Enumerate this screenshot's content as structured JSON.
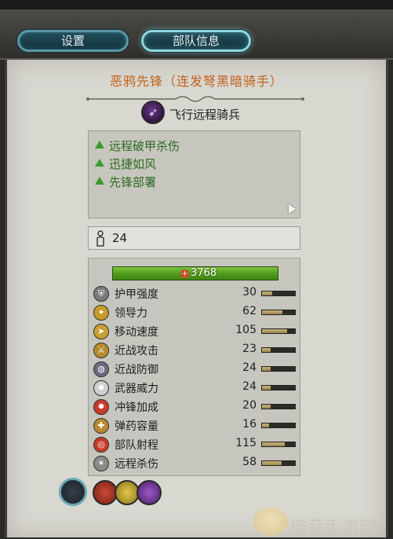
{
  "tabs": [
    {
      "label": "设置",
      "active": false
    },
    {
      "label": "部队信息",
      "active": true
    }
  ],
  "unit": {
    "name": "恶鸦先锋（连发弩黑暗骑手）",
    "class_label": "飞行远程骑兵",
    "class_icon": "crossbow-icon"
  },
  "traits": [
    {
      "label": "远程破甲杀伤",
      "icon": "green-triangle-icon"
    },
    {
      "label": "迅捷如风",
      "icon": "green-triangle-icon"
    },
    {
      "label": "先锋部署",
      "icon": "green-triangle-icon"
    }
  ],
  "men": {
    "icon": "soldier-icon",
    "value": "24"
  },
  "hp": {
    "value": "3768",
    "fraction": 1.0
  },
  "stats": [
    {
      "label": "护甲强度",
      "value": "30",
      "fraction": 0.3,
      "icon": "armor-icon",
      "color": "#7a7a7a"
    },
    {
      "label": "领导力",
      "value": "62",
      "fraction": 0.62,
      "icon": "leadership-icon",
      "color": "#c89a28"
    },
    {
      "label": "移动速度",
      "value": "105",
      "fraction": 0.75,
      "icon": "speed-icon",
      "color": "#c8a030"
    },
    {
      "label": "近战攻击",
      "value": "23",
      "fraction": 0.25,
      "icon": "sword-icon",
      "color": "#b88a30"
    },
    {
      "label": "近战防御",
      "value": "24",
      "fraction": 0.27,
      "icon": "shield-icon",
      "color": "#6a6a80"
    },
    {
      "label": "武器威力",
      "value": "24",
      "fraction": 0.27,
      "icon": "weapon-strength-icon",
      "color": "#cfcfcf"
    },
    {
      "label": "冲锋加成",
      "value": "20",
      "fraction": 0.25,
      "icon": "charge-icon",
      "color": "#c83a2a"
    },
    {
      "label": "弹药容量",
      "value": "16",
      "fraction": 0.22,
      "icon": "ammo-icon",
      "color": "#b88a30"
    },
    {
      "label": "部队射程",
      "value": "115",
      "fraction": 0.68,
      "icon": "range-icon",
      "color": "#c83a2a"
    },
    {
      "label": "远程杀伤",
      "value": "58",
      "fraction": 0.6,
      "icon": "missile-damage-icon",
      "color": "#8a8a8a"
    }
  ],
  "abilities": [
    {
      "name": "fast-attack-icon",
      "color": "#b83a2a"
    },
    {
      "name": "eye-icon",
      "color": "#c8b030"
    },
    {
      "name": "poison-icon",
      "color": "#7a3a9a"
    }
  ],
  "unit_badge": "skull-badge-icon",
  "watermark": {
    "text": "倍菲手游网",
    "icon": "watermark-logo"
  }
}
